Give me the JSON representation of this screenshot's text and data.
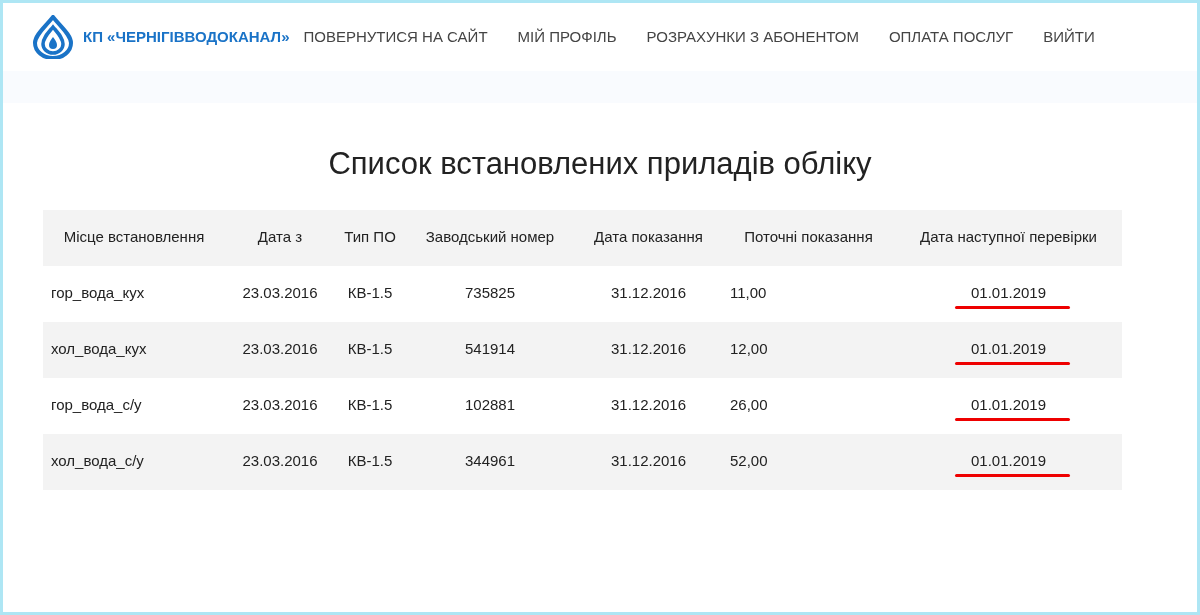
{
  "header": {
    "brand": "КП «ЧЕРНІГІВВОДОКАНАЛ»",
    "nav": [
      "ПОВЕРНУТИСЯ НА САЙТ",
      "МІЙ ПРОФІЛЬ",
      "РОЗРАХУНКИ З АБОНЕНТОМ",
      "ОПЛАТА ПОСЛУГ",
      "ВИЙТИ"
    ]
  },
  "title": "Список встановлених приладів обліку",
  "table": {
    "columns": [
      "Місце встановлення",
      "Дата з",
      "Тип ПО",
      "Заводський номер",
      "Дата показання",
      "Поточні показання",
      "Дата наступної перевірки"
    ],
    "rows": [
      {
        "cells": [
          "гор_вода_кух",
          "23.03.2016",
          "КВ-1.5",
          "735825",
          "31.12.2016",
          "11,00",
          "01.01.2019"
        ],
        "underlined": true
      },
      {
        "cells": [
          "хол_вода_кух",
          "23.03.2016",
          "КВ-1.5",
          "541914",
          "31.12.2016",
          "12,00",
          "01.01.2019"
        ],
        "underlined": true
      },
      {
        "cells": [
          "гор_вода_с/у",
          "23.03.2016",
          "КВ-1.5",
          "102881",
          "31.12.2016",
          "26,00",
          "01.01.2019"
        ],
        "underlined": true
      },
      {
        "cells": [
          "хол_вода_с/у",
          "23.03.2016",
          "КВ-1.5",
          "344961",
          "31.12.2016",
          "52,00",
          "01.01.2019"
        ],
        "underlined": true
      }
    ]
  }
}
